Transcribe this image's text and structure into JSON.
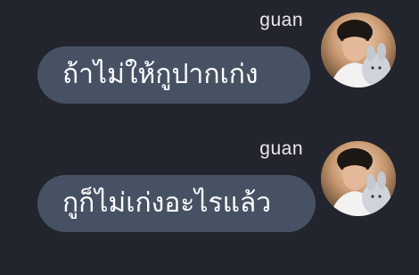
{
  "messages": [
    {
      "sender": "guan",
      "text": "ถ้าไม่ให้กูปากเก่ง"
    },
    {
      "sender": "guan",
      "text": "กูก็ไม่เก่งอะไรแล้ว"
    }
  ],
  "colors": {
    "background": "#22252d",
    "bubble": "#465264",
    "text": "#ffffff",
    "sender_text": "#e8e9ec"
  }
}
